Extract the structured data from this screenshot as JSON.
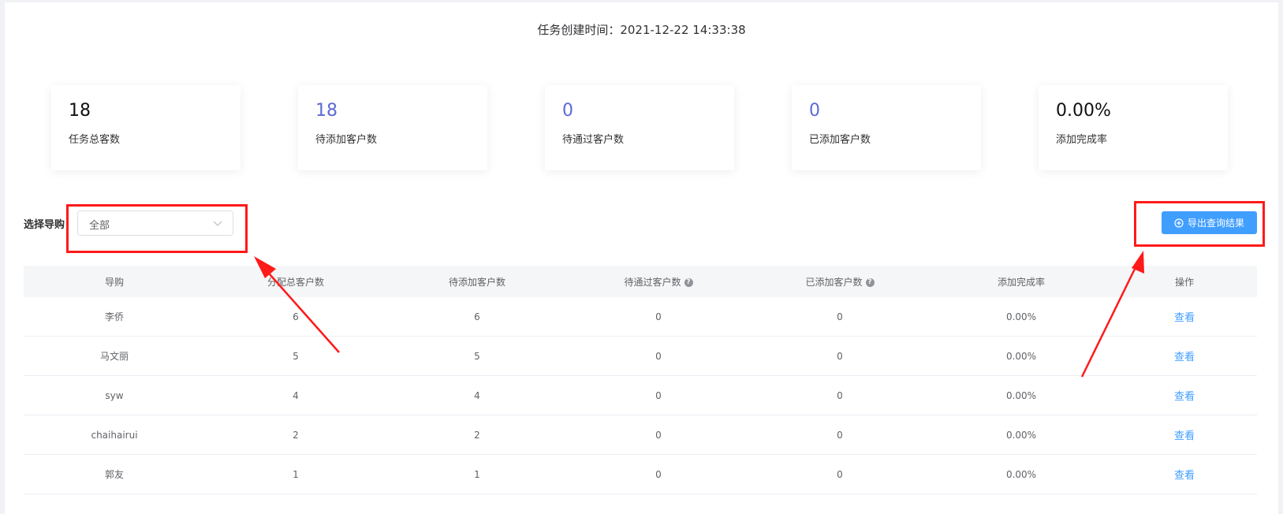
{
  "header": {
    "task_time": "任务创建时间：2021-12-22 14:33:38"
  },
  "stats": [
    {
      "value": "18",
      "label": "任务总客数",
      "accent": false
    },
    {
      "value": "18",
      "label": "待添加客户数",
      "accent": true
    },
    {
      "value": "0",
      "label": "待通过客户数",
      "accent": true
    },
    {
      "value": "0",
      "label": "已添加客户数",
      "accent": true
    },
    {
      "value": "0.00%",
      "label": "添加完成率",
      "accent": false
    }
  ],
  "filter": {
    "label": "选择导购",
    "selected": "全部"
  },
  "export": {
    "label": "导出查询结果",
    "icon": "plus-circle-icon"
  },
  "table": {
    "headers": [
      "导购",
      "分配总客户数",
      "待添加客户数",
      "待通过客户数",
      "已添加客户数",
      "添加完成率",
      "操作"
    ],
    "rows": [
      [
        "李侨",
        "6",
        "6",
        "0",
        "0",
        "0.00%",
        "查看"
      ],
      [
        "马文丽",
        "5",
        "5",
        "0",
        "0",
        "0.00%",
        "查看"
      ],
      [
        "syw",
        "4",
        "4",
        "0",
        "0",
        "0.00%",
        "查看"
      ],
      [
        "chaihairui",
        "2",
        "2",
        "0",
        "0",
        "0.00%",
        "查看"
      ],
      [
        "郭友",
        "1",
        "1",
        "0",
        "0",
        "0.00%",
        "查看"
      ]
    ]
  },
  "colors": {
    "accent": "#5b6ad6",
    "primary": "#409eff",
    "annotation": "#ff1a1a"
  }
}
